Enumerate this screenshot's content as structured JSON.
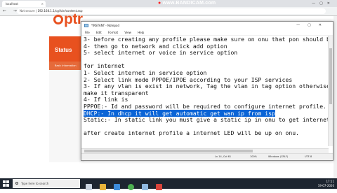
{
  "browser": {
    "tab_title": "localhost",
    "url_prefix": "Not secure |",
    "url": "192.168.1.1/cgi-bin/content.asp",
    "nav_glyphs": "← → ⟳"
  },
  "recorder": {
    "dot": "●",
    "label": "www.BANDICAM.com"
  },
  "router": {
    "logo_rest": "ptr",
    "status_label": "Status",
    "sub_label": "Basic Information"
  },
  "notepad": {
    "title": "*INSTANT - Notepad",
    "menu": [
      "File",
      "Edit",
      "Format",
      "View",
      "Help"
    ],
    "lines_before": [
      "3- before creating any profile please make sure on onu that pon should be",
      "4- then go to network and click add option",
      "5- select internet or voice in service option",
      "",
      "for internet",
      "1- Select internet in service option",
      "2- Select link mode PPPOE/IPOE according to your ISP services",
      "3- If any vlan is exist in network, Tag the vlan in tag option otherwise",
      "make it transparent",
      "4- If link is",
      "PPPOE:- Id and password will be required to configure internet profile."
    ],
    "highlight_line": "DHCP:- In dhcp it will get automatic get wan ip from isp",
    "lines_after": [
      "Static:- In static link you must give a static ip in onu to get internet",
      "",
      "after create internet profile a internet LED will be up on onu."
    ],
    "status": {
      "position": "Ln 14, Col 61",
      "zoom": "100%",
      "eol": "Windows (CRLF)",
      "encoding": "UTF-8"
    }
  },
  "taskbar": {
    "search_placeholder": "Type here to search",
    "time": "17:11",
    "date": "19-07-2020"
  },
  "colors": {
    "brand": "#e8511f",
    "highlight": "#0a64d6",
    "taskbar": "#1d2530"
  }
}
